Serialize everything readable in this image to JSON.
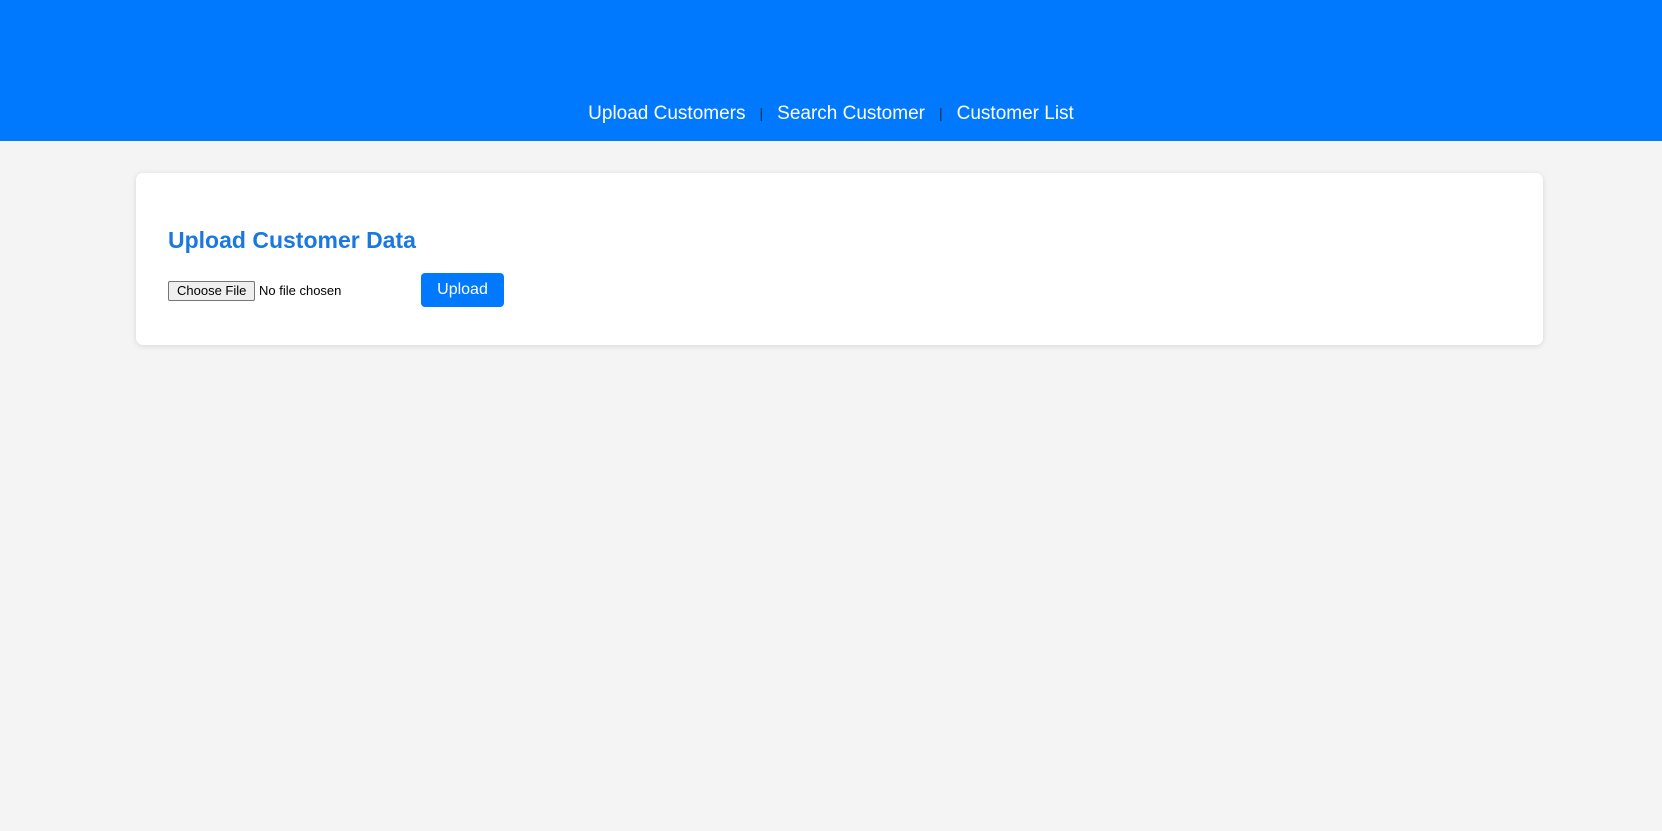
{
  "nav": {
    "items": [
      {
        "label": "Upload Customers"
      },
      {
        "label": "Search Customer"
      },
      {
        "label": "Customer List"
      }
    ],
    "separator": "|"
  },
  "upload_card": {
    "title": "Upload Customer Data",
    "choose_file_label": "Choose File",
    "file_status": "No file chosen",
    "upload_label": "Upload"
  },
  "colors": {
    "brand": "#0079ff",
    "title": "#1a78e0",
    "background": "#f4f4f4"
  }
}
